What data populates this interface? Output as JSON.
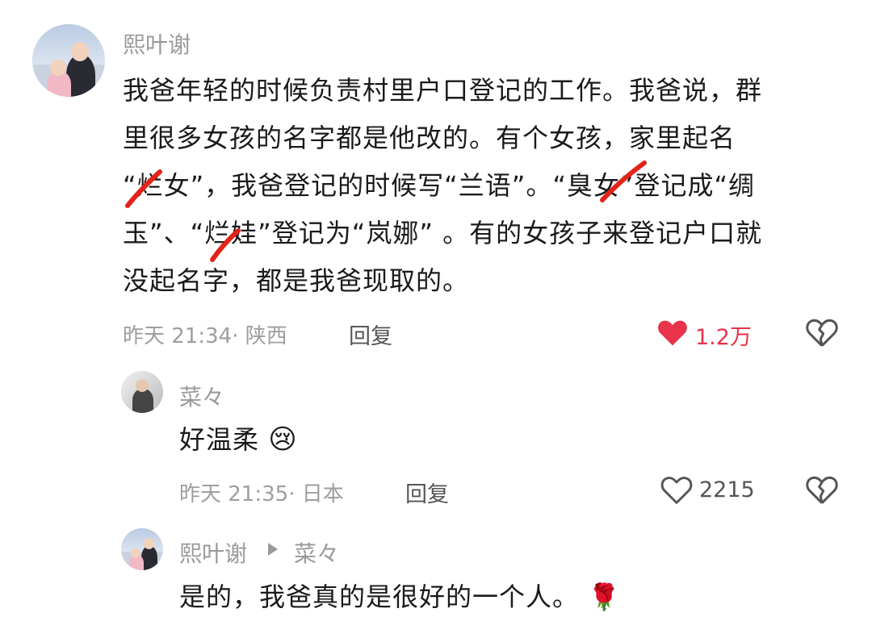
{
  "comment": {
    "author": "熙叶谢",
    "lines": [
      "我爸年轻的时候负责村里户口登记的工作。我爸说，群",
      "里很多女孩的名字都是他改的。有个女孩，家里起名",
      "“烂女”，我爸登记的时候写“兰语”。“臭女”登记成“绸",
      "玉”、“烂娃”登记为“岚娜” 。有的女孩子来登记户口就",
      "没起名字，都是我爸现取的。"
    ],
    "time_location": "昨天 21:34· 陕西",
    "reply_label": "回复",
    "likes": "1.2万",
    "like_color": "#e8334a"
  },
  "reply1": {
    "author": "菜々",
    "text": "好温柔",
    "emoji": "😢",
    "time_location": "昨天 21:35· 日本",
    "reply_label": "回复",
    "likes": "2215"
  },
  "reply2": {
    "author": "熙叶谢",
    "reply_to": "菜々",
    "text": "是的，我爸真的是很好的一个人。",
    "emoji": "🌹"
  },
  "icons": [
    "avatar",
    "heart-filled-icon",
    "heart-outline-icon",
    "broken-heart-icon",
    "play-arrow-icon",
    "crying-emoji-icon",
    "rose-icon"
  ]
}
